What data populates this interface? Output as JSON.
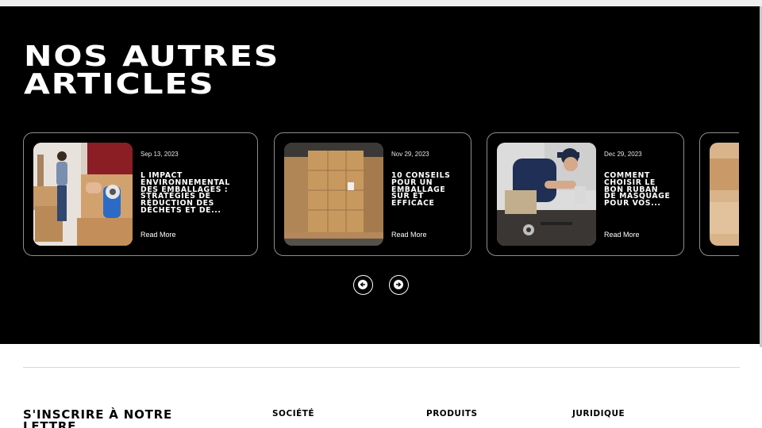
{
  "section": {
    "title_line1": "NOS AUTRES",
    "title_line2": "ARTICLES"
  },
  "articles": [
    {
      "date": "Sep 13, 2023",
      "title": "L IMPACT ENVIRONNEMENTAL DES EMBALLAGES : STRATÉGIES DE RÉDUCTION DES DÉCHETS ET DE...",
      "link": "Read More",
      "image": "packing-tape-dispenser-photo"
    },
    {
      "date": "Nov 29, 2023",
      "title": "10 CONSEILS POUR UN EMBALLAGE SÛR ET EFFICACE",
      "link": "Read More",
      "image": "warehouse-boxes-pallet-photo"
    },
    {
      "date": "Dec 29, 2023",
      "title": "COMMENT CHOISIR LE BON RUBAN DE MASQUAGE POUR VOS...",
      "link": "Read More",
      "image": "worker-masking-tape-photo"
    }
  ],
  "carousel": {
    "prev_icon": "arrow-left-icon",
    "next_icon": "arrow-right-icon"
  },
  "footer": {
    "newsletter_title": "S'INSCRIRE À NOTRE LETTRE",
    "col1": "SOCIÉTÉ",
    "col2": "PRODUITS",
    "col3": "JURIDIQUE"
  },
  "colors": {
    "background": "#000000",
    "text": "#ffffff",
    "card_border": "#8d8d8d"
  }
}
